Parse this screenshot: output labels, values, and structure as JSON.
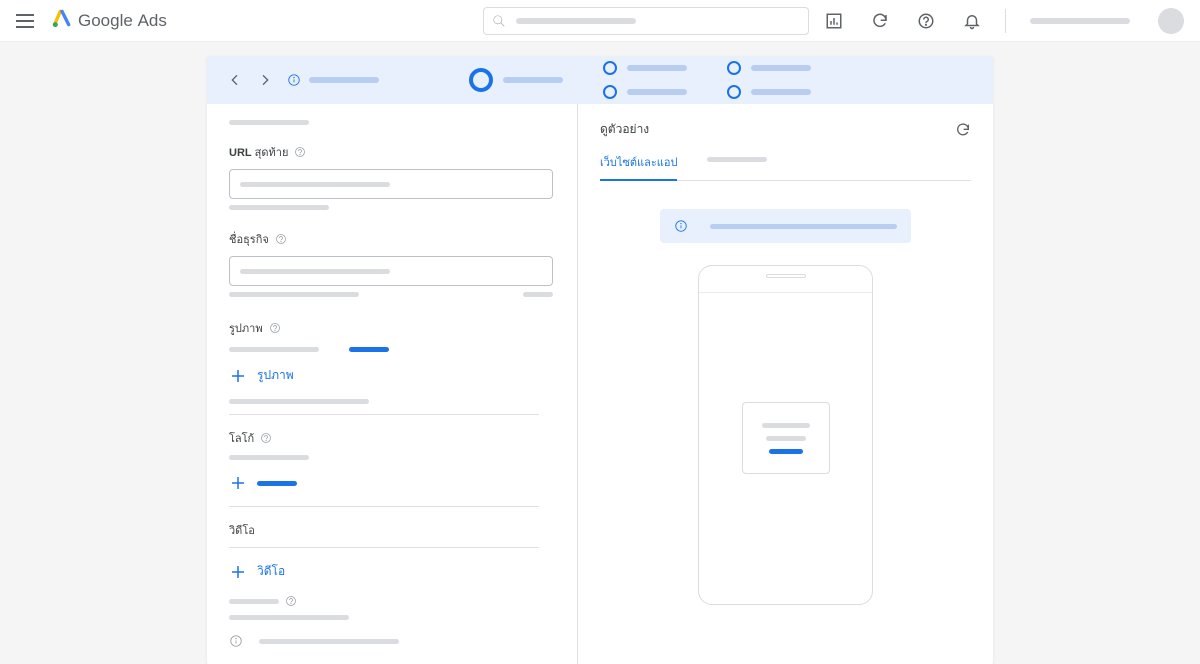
{
  "header": {
    "logo_text": "Google",
    "logo_suffix": "Ads"
  },
  "form": {
    "final_url_label_prefix": "URL",
    "final_url_label": "สุดท้าย",
    "business_name_label": "ชื่อธุรกิจ",
    "images_section": "รูปภาพ",
    "add_images": "รูปภาพ",
    "logos_section": "โลโก้",
    "videos_section": "วิดีโอ",
    "add_videos": "วิดีโอ"
  },
  "preview": {
    "title": "ดูตัวอย่าง",
    "tab_websites": "เว็บไซต์และแอป"
  }
}
